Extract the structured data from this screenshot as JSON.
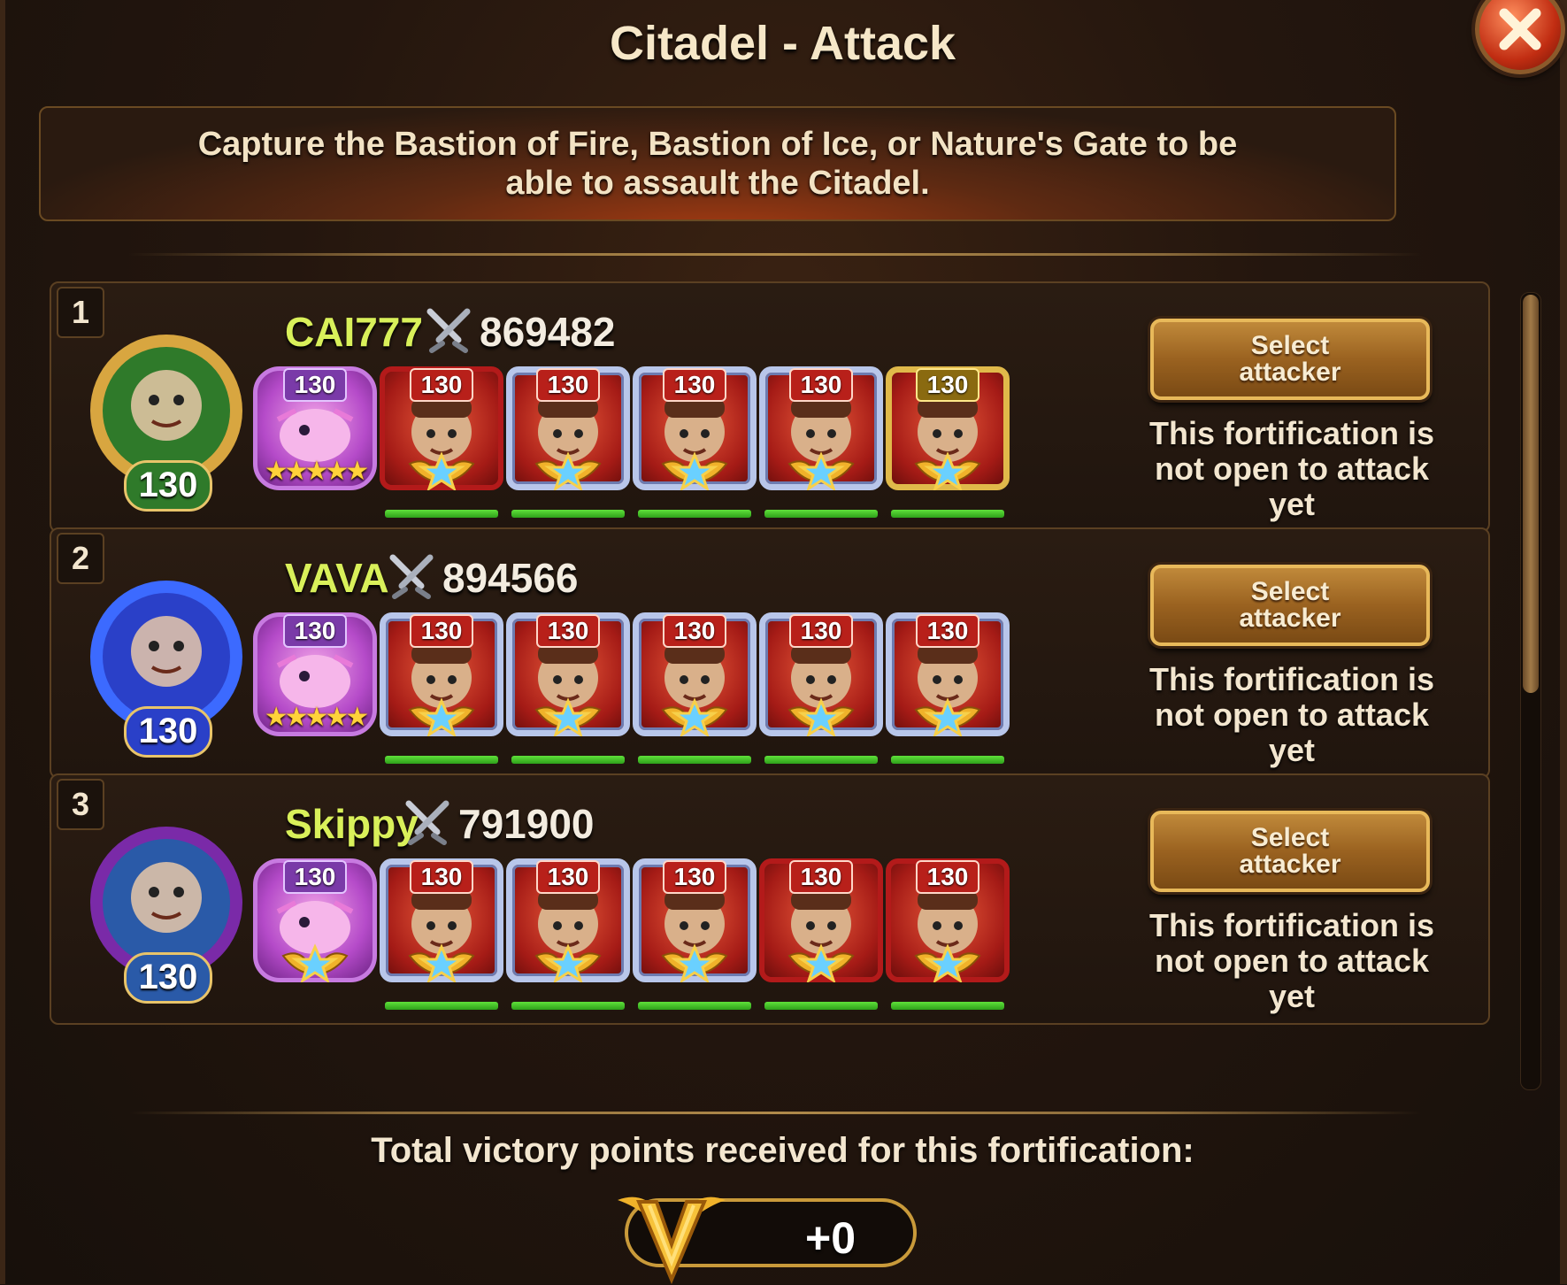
{
  "window": {
    "title": "Citadel - Attack",
    "close_icon": "close-x-icon"
  },
  "info": {
    "text": "Capture the Bastion of Fire, Bastion of Ice, or Nature's Gate to be able to assault the Citadel."
  },
  "rows": [
    {
      "rank": "1",
      "name": "CAI777",
      "power": "869482",
      "avatar_level": "130",
      "avatar_color": "#2f7a2a",
      "avatar_ring": "#d8a640",
      "heroes": [
        {
          "level": "130",
          "type": "pet",
          "stars": "★★★★★"
        },
        {
          "level": "130",
          "type": "red"
        },
        {
          "level": "130",
          "type": "blue"
        },
        {
          "level": "130",
          "type": "blue"
        },
        {
          "level": "130",
          "type": "blue"
        },
        {
          "level": "130",
          "type": "gold"
        }
      ],
      "button": "Select attacker",
      "status": "This fortification is not open to attack yet"
    },
    {
      "rank": "2",
      "name": "VAVA",
      "power": "894566",
      "avatar_level": "130",
      "avatar_color": "#2a40c8",
      "avatar_ring": "#3c6aff",
      "heroes": [
        {
          "level": "130",
          "type": "pet",
          "stars": "★★★★★"
        },
        {
          "level": "130",
          "type": "blue"
        },
        {
          "level": "130",
          "type": "blue"
        },
        {
          "level": "130",
          "type": "blue"
        },
        {
          "level": "130",
          "type": "blue"
        },
        {
          "level": "130",
          "type": "blue"
        }
      ],
      "button": "Select attacker",
      "status": "This fortification is not open to attack yet"
    },
    {
      "rank": "3",
      "name": "Skippy",
      "power": "791900",
      "avatar_level": "130",
      "avatar_color": "#2a5aa8",
      "avatar_ring": "#7a2aa8",
      "heroes": [
        {
          "level": "130",
          "type": "pet"
        },
        {
          "level": "130",
          "type": "blue"
        },
        {
          "level": "130",
          "type": "blue"
        },
        {
          "level": "130",
          "type": "blue"
        },
        {
          "level": "130",
          "type": "red"
        },
        {
          "level": "130",
          "type": "red"
        }
      ],
      "button": "Select attacker",
      "status": "This fortification is not open to attack yet"
    }
  ],
  "footer": {
    "label": "Total victory points received for this fortification:",
    "value": "+0",
    "icon": "victory-v-icon"
  }
}
